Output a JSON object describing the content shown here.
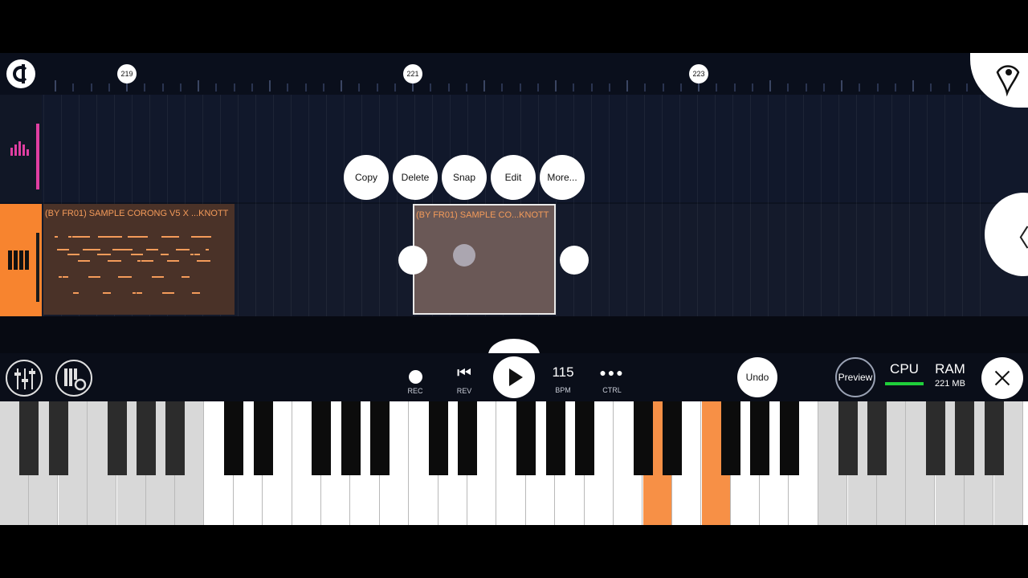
{
  "timeline": {
    "markers": [
      "219",
      "221",
      "223"
    ]
  },
  "context_menu": {
    "copy": "Copy",
    "delete": "Delete",
    "snap": "Snap",
    "edit": "Edit",
    "more": "More..."
  },
  "tracks": {
    "clip_1_label": "(BY FR01) SAMPLE CORONG V5 X ...KNOTT",
    "clip_2_label": "(BY FR01) SAMPLE CO...KNOTT"
  },
  "toolbar": {
    "rec_label": "REC",
    "rev_label": "REV",
    "bpm_value": "115",
    "bpm_label": "BPM",
    "ctrl_label": "CTRL",
    "undo_label": "Undo",
    "preview_label": "Preview",
    "cpu_label": "CPU",
    "ram_label": "RAM",
    "ram_value": "221 MB"
  },
  "icons": {
    "logo": "fl-logo-icon",
    "fruit": "fl-fruit-icon",
    "mixer": "mixer-icon",
    "settings": "piano-settings-icon",
    "collapse": "chevron-left-icon",
    "close": "close-icon"
  },
  "colors": {
    "accent_orange": "#f7842f",
    "accent_pink": "#e03ea1",
    "cpu_meter": "#1fcf3a"
  }
}
